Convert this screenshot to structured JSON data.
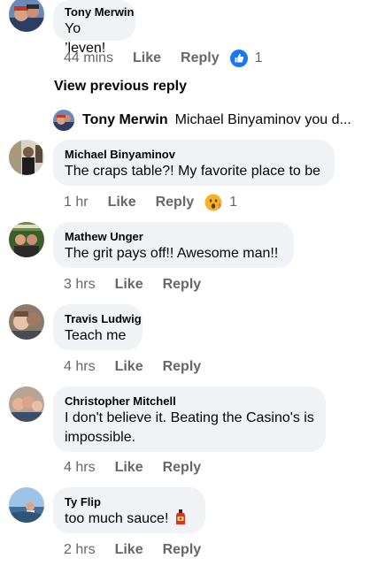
{
  "comments": [
    {
      "author": "Tony Merwin",
      "text": "Yo ’leven!",
      "time": "44 mins",
      "like": "Like",
      "reply": "Reply",
      "reaction_icon": "like-reaction-icon",
      "reaction_count": "1"
    },
    {
      "author": "Michael Binyaminov",
      "text": "The craps table?! My favorite place to be",
      "time": "1 hr",
      "like": "Like",
      "reply": "Reply",
      "reaction_icon": "wow-reaction-icon",
      "reaction_count": "1"
    },
    {
      "author": "Mathew Unger",
      "text": "The grit pays off!! Awesome man!!",
      "time": "3 hrs",
      "like": "Like",
      "reply": "Reply"
    },
    {
      "author": "Travis Ludwig",
      "text": "Teach me",
      "time": "4 hrs",
      "like": "Like",
      "reply": "Reply"
    },
    {
      "author": "Christopher Mitchell",
      "text": "I don't believe it. Beating the Casino's is impossible.",
      "time": "4 hrs",
      "like": "Like",
      "reply": "Reply"
    },
    {
      "author": "Ty Flip",
      "text": "too much sauce!",
      "time": "2 hrs",
      "like": "Like",
      "reply": "Reply"
    }
  ],
  "view_previous": "View previous reply",
  "reply_preview": {
    "author": "Tony Merwin",
    "text": "Michael Binyaminov you d..."
  },
  "colors": {
    "bubble": "#f0f2f5",
    "secondary_text": "#65676b",
    "like_blue": "#1877f2"
  }
}
